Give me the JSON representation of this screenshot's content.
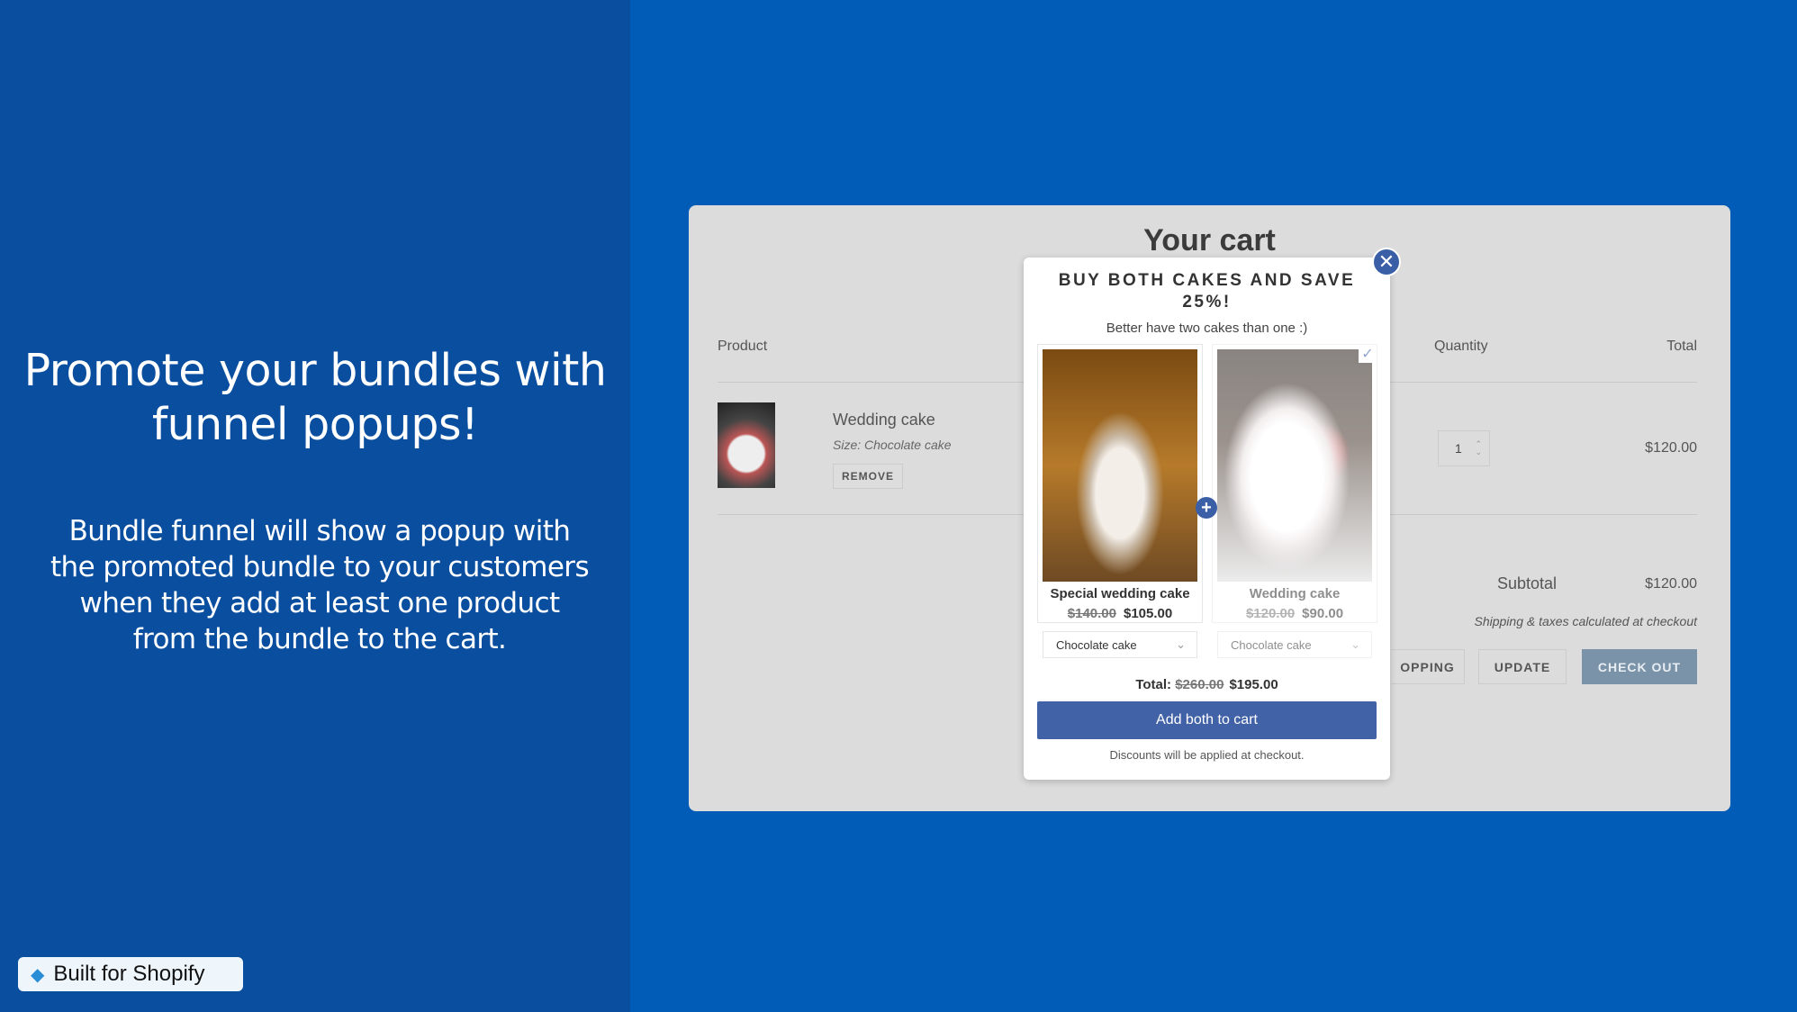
{
  "promo": {
    "title": "Promote your bundles with funnel popups!",
    "body": "Bundle funnel will show a popup with the promoted bundle to your customers when they add at least one product from the bundle to the cart.",
    "badge": "Built for Shopify",
    "badge_icon": "diamond-icon"
  },
  "cart": {
    "title": "Your cart",
    "headers": {
      "product": "Product",
      "quantity": "Quantity",
      "total": "Total"
    },
    "item": {
      "name": "Wedding cake",
      "size": "Size: Chocolate cake",
      "remove": "REMOVE",
      "quantity": "1",
      "total": "$120.00"
    },
    "subtotal_label": "Subtotal",
    "subtotal": "$120.00",
    "shipping_note": "Shipping & taxes calculated at checkout",
    "buttons": {
      "continue": "OPPING",
      "update": "UPDATE",
      "checkout": "CHECK OUT"
    }
  },
  "popup": {
    "title": "BUY BOTH CAKES AND SAVE 25%!",
    "subtitle": "Better have two cakes than one :)",
    "products": [
      {
        "name": "Special wedding cake",
        "old_price": "$140.00",
        "price": "$105.00",
        "variant": "Chocolate cake",
        "selected": false
      },
      {
        "name": "Wedding cake",
        "old_price": "$120.00",
        "price": "$90.00",
        "variant": "Chocolate cake",
        "selected": true
      }
    ],
    "total_label": "Total:",
    "total_old": "$260.00",
    "total": "$195.00",
    "add_button": "Add both to cart",
    "note": "Discounts will be applied at checkout."
  },
  "colors": {
    "left_bg": "#0a4e9f",
    "right_bg": "#015cb7",
    "accent": "#4262a8",
    "checkout": "#7a93a8"
  }
}
